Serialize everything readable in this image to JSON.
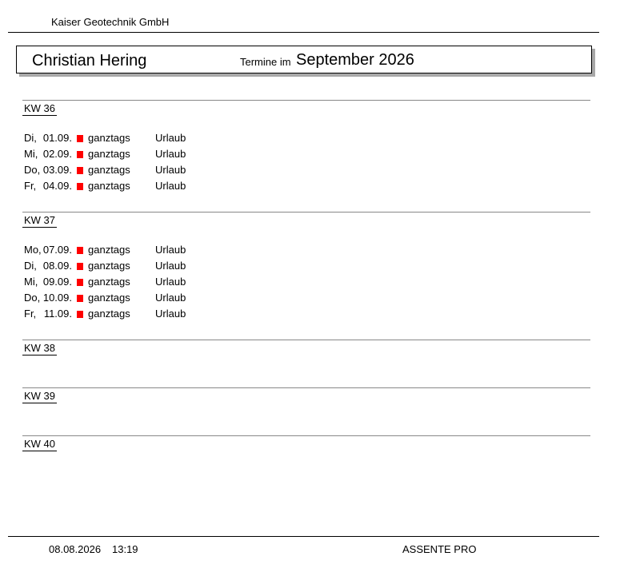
{
  "company": "Kaiser Geotechnik GmbH",
  "header": {
    "person": "Christian Hering",
    "termine_label": "Termine im",
    "month": "September 2026"
  },
  "weeks": [
    {
      "label": "KW 36",
      "entries": [
        {
          "dow": "Di,",
          "date": "01.09.",
          "time": "ganztags",
          "note": "Urlaub"
        },
        {
          "dow": "Mi,",
          "date": "02.09.",
          "time": "ganztags",
          "note": "Urlaub"
        },
        {
          "dow": "Do,",
          "date": "03.09.",
          "time": "ganztags",
          "note": "Urlaub"
        },
        {
          "dow": "Fr,",
          "date": "04.09.",
          "time": "ganztags",
          "note": "Urlaub"
        }
      ]
    },
    {
      "label": "KW 37",
      "entries": [
        {
          "dow": "Mo,",
          "date": "07.09.",
          "time": "ganztags",
          "note": "Urlaub"
        },
        {
          "dow": "Di,",
          "date": "08.09.",
          "time": "ganztags",
          "note": "Urlaub"
        },
        {
          "dow": "Mi,",
          "date": "09.09.",
          "time": "ganztags",
          "note": "Urlaub"
        },
        {
          "dow": "Do,",
          "date": "10.09.",
          "time": "ganztags",
          "note": "Urlaub"
        },
        {
          "dow": "Fr,",
          "date": "11.09.",
          "time": "ganztags",
          "note": "Urlaub"
        }
      ]
    },
    {
      "label": "KW 38",
      "entries": []
    },
    {
      "label": "KW 39",
      "entries": []
    },
    {
      "label": "KW 40",
      "entries": []
    }
  ],
  "entry_marker_color": "#ff0000",
  "footer": {
    "date": "08.08.2026",
    "time": "13:19",
    "product": "ASSENTE PRO"
  }
}
